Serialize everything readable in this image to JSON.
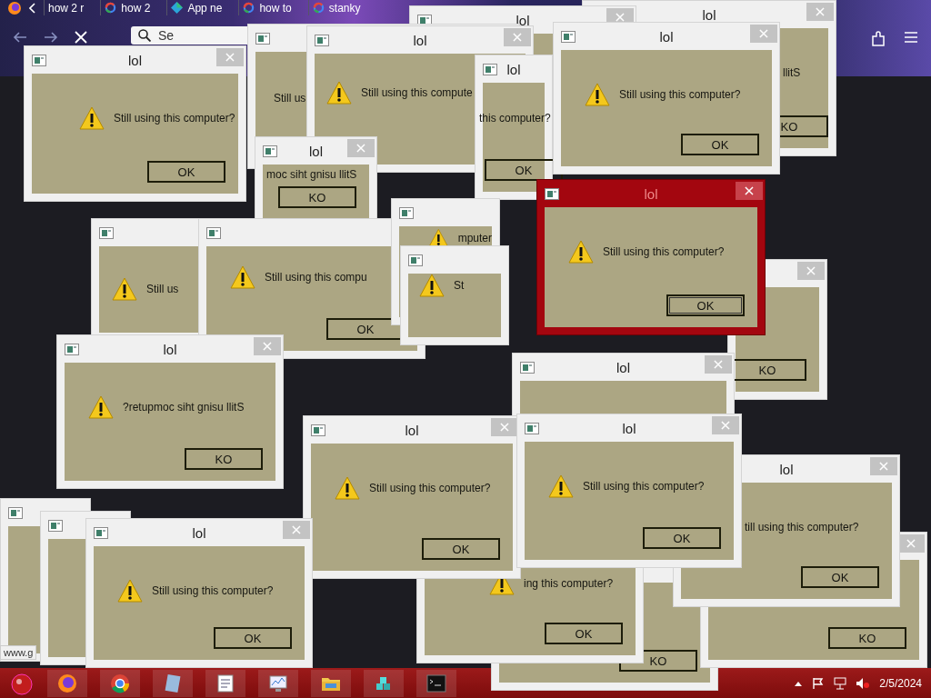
{
  "browser": {
    "tabs": [
      {
        "label": "how 2 r"
      },
      {
        "label": "how 2"
      },
      {
        "label": "App ne"
      },
      {
        "label": "how to"
      },
      {
        "label": "stanky"
      }
    ],
    "search": {
      "placeholder": "Se"
    }
  },
  "windows": [
    {
      "title": "lol",
      "message": "llitS",
      "button": "KO",
      "close": "×",
      "active": false
    },
    {
      "title": "lol",
      "close": "×",
      "active": false
    },
    {
      "message": "Still us",
      "active": false
    },
    {
      "title": "lol",
      "message": "Still using this compute",
      "close": "×",
      "active": false
    },
    {
      "title": "lol",
      "message": "this computer?",
      "button": "OK",
      "active": false
    },
    {
      "message": "Still us",
      "active": false
    },
    {
      "title": "lol",
      "message": "moc siht gnisu llitS",
      "button": "KO",
      "close": "×",
      "active": false
    },
    {
      "message": "Still using this compu",
      "button": "OK",
      "active": false
    },
    {
      "message": "mputer",
      "active": false
    },
    {
      "message": "St",
      "active": false
    },
    {
      "button": "KO",
      "close": "×",
      "active": false
    },
    {
      "active": false
    },
    {
      "active": false
    },
    {
      "button": "KO",
      "active": false
    },
    {
      "message": "ing this computer?",
      "button": "OK",
      "active": false
    },
    {
      "button": "KO",
      "close": "×",
      "active": false
    },
    {
      "title": "lol",
      "message": "till using this computer?",
      "button": "OK",
      "close": "×",
      "active": false
    },
    {
      "title": "lol",
      "message": "Still using this computer?",
      "button": "OK",
      "close": "×",
      "active": false
    },
    {
      "title": "lol",
      "message": "Still using this computer?",
      "button": "OK",
      "close": "×",
      "active": false
    },
    {
      "title": "lol",
      "message": "Still using this computer?",
      "button": "OK",
      "close": "×",
      "active": true
    },
    {
      "title": "lol",
      "message": "?retupmoc siht gnisu llitS",
      "button": "KO",
      "close": "×",
      "active": false
    },
    {
      "title": "lol",
      "close": "×",
      "active": false
    },
    {
      "title": "lol",
      "message": "Still using this computer?",
      "button": "OK",
      "close": "×",
      "active": false
    },
    {
      "title": "lol",
      "message": "Still using this computer?",
      "button": "OK",
      "close": "×",
      "active": false
    },
    {
      "title": "lol",
      "message": "Still using this computer?",
      "button": "OK",
      "close": "×",
      "active": false
    }
  ],
  "status_bar": {
    "url": "www.g"
  },
  "taskbar": {
    "date": "2/5/2024"
  }
}
